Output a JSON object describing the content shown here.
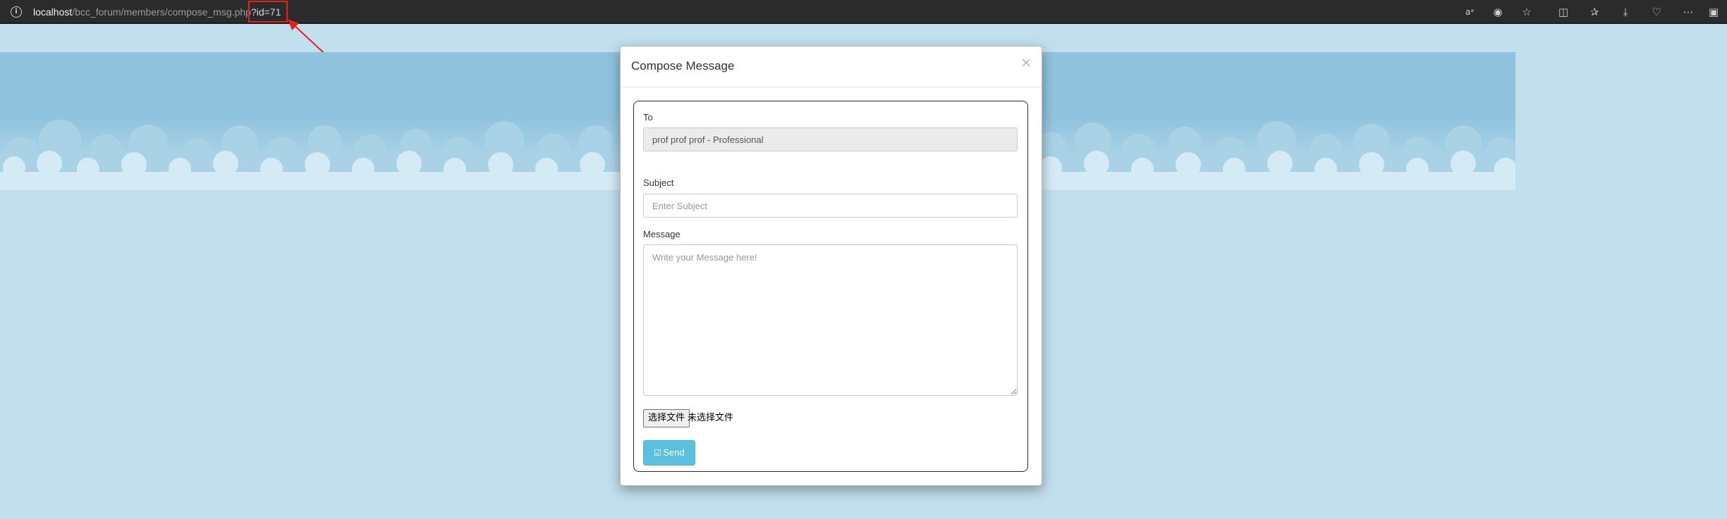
{
  "browser": {
    "url_host": "localhost",
    "url_path": "/bcc_forum/members/compose_msg.php",
    "url_query": "?id=71",
    "toolbar_icons": [
      "read-aloud-icon",
      "tracking-icon",
      "favorite-star-icon",
      "split-screen-icon",
      "favorites-icon",
      "downloads-icon",
      "browser-essentials-icon",
      "more-icon",
      "sidebar-icon"
    ]
  },
  "modal": {
    "title": "Compose Message",
    "close_label": "×",
    "to_label": "To",
    "to_value": "prof prof prof - Professional",
    "subject_label": "Subject",
    "subject_placeholder": "Enter Subject",
    "message_label": "Message",
    "message_placeholder": "Write your Message here!",
    "file_button_label": "选择文件",
    "file_status": "未选择文件",
    "send_label": "Send"
  },
  "colors": {
    "page_background": "#c2dfee",
    "sky": "#8fc3de",
    "send_button": "#5bc0de",
    "annotation": "#e4231b"
  }
}
